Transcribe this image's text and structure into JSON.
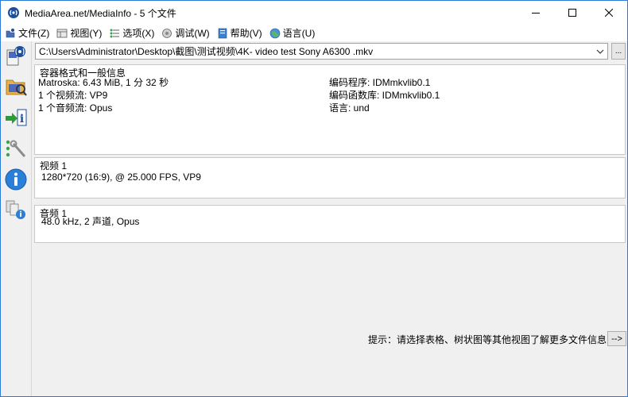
{
  "window": {
    "title": "MediaArea.net/MediaInfo - 5 个文件",
    "controls": {
      "minimize": "minimize-icon",
      "maximize": "maximize-icon",
      "close": "close-icon"
    }
  },
  "menu": [
    {
      "label": "文件(Z)",
      "icon": "file-icon"
    },
    {
      "label": "视图(Y)",
      "icon": "view-icon"
    },
    {
      "label": "选项(X)",
      "icon": "options-icon"
    },
    {
      "label": "调试(W)",
      "icon": "debug-icon"
    },
    {
      "label": "帮助(V)",
      "icon": "help-icon"
    },
    {
      "label": "语言(U)",
      "icon": "language-icon"
    }
  ],
  "toolbar": [
    {
      "name": "open-file-tool",
      "icon": "open-file-icon"
    },
    {
      "name": "open-folder-tool",
      "icon": "open-folder-icon"
    },
    {
      "name": "export-tool",
      "icon": "export-icon"
    },
    {
      "name": "preferences-tool",
      "icon": "preferences-icon"
    },
    {
      "name": "about-tool",
      "icon": "info-icon"
    },
    {
      "name": "knowledge-tool",
      "icon": "knowledge-icon"
    }
  ],
  "file_selector": {
    "path": "C:\\Users\\Administrator\\Desktop\\截图\\测试视频\\4K- video test Sony A6300 .mkv",
    "browse_label": "..."
  },
  "general": {
    "title": "容器格式和一般信息",
    "left": [
      "Matroska: 6.43 MiB, 1 分 32 秒",
      "1 个视频流: VP9",
      "1 个音频流: Opus"
    ],
    "right": [
      "编码程序: IDMmkvlib0.1",
      "编码函数库: IDMmkvlib0.1",
      "语言: und"
    ]
  },
  "video": {
    "title": "视频 1",
    "line": "1280*720 (16:9), @ 25.000 FPS, VP9"
  },
  "audio": {
    "title": "音频 1",
    "line": "48.0 kHz, 2 声道, Opus"
  },
  "hint": {
    "text": "提示：请选择表格、树状图等其他视图了解更多文件信息",
    "button": "-->"
  }
}
